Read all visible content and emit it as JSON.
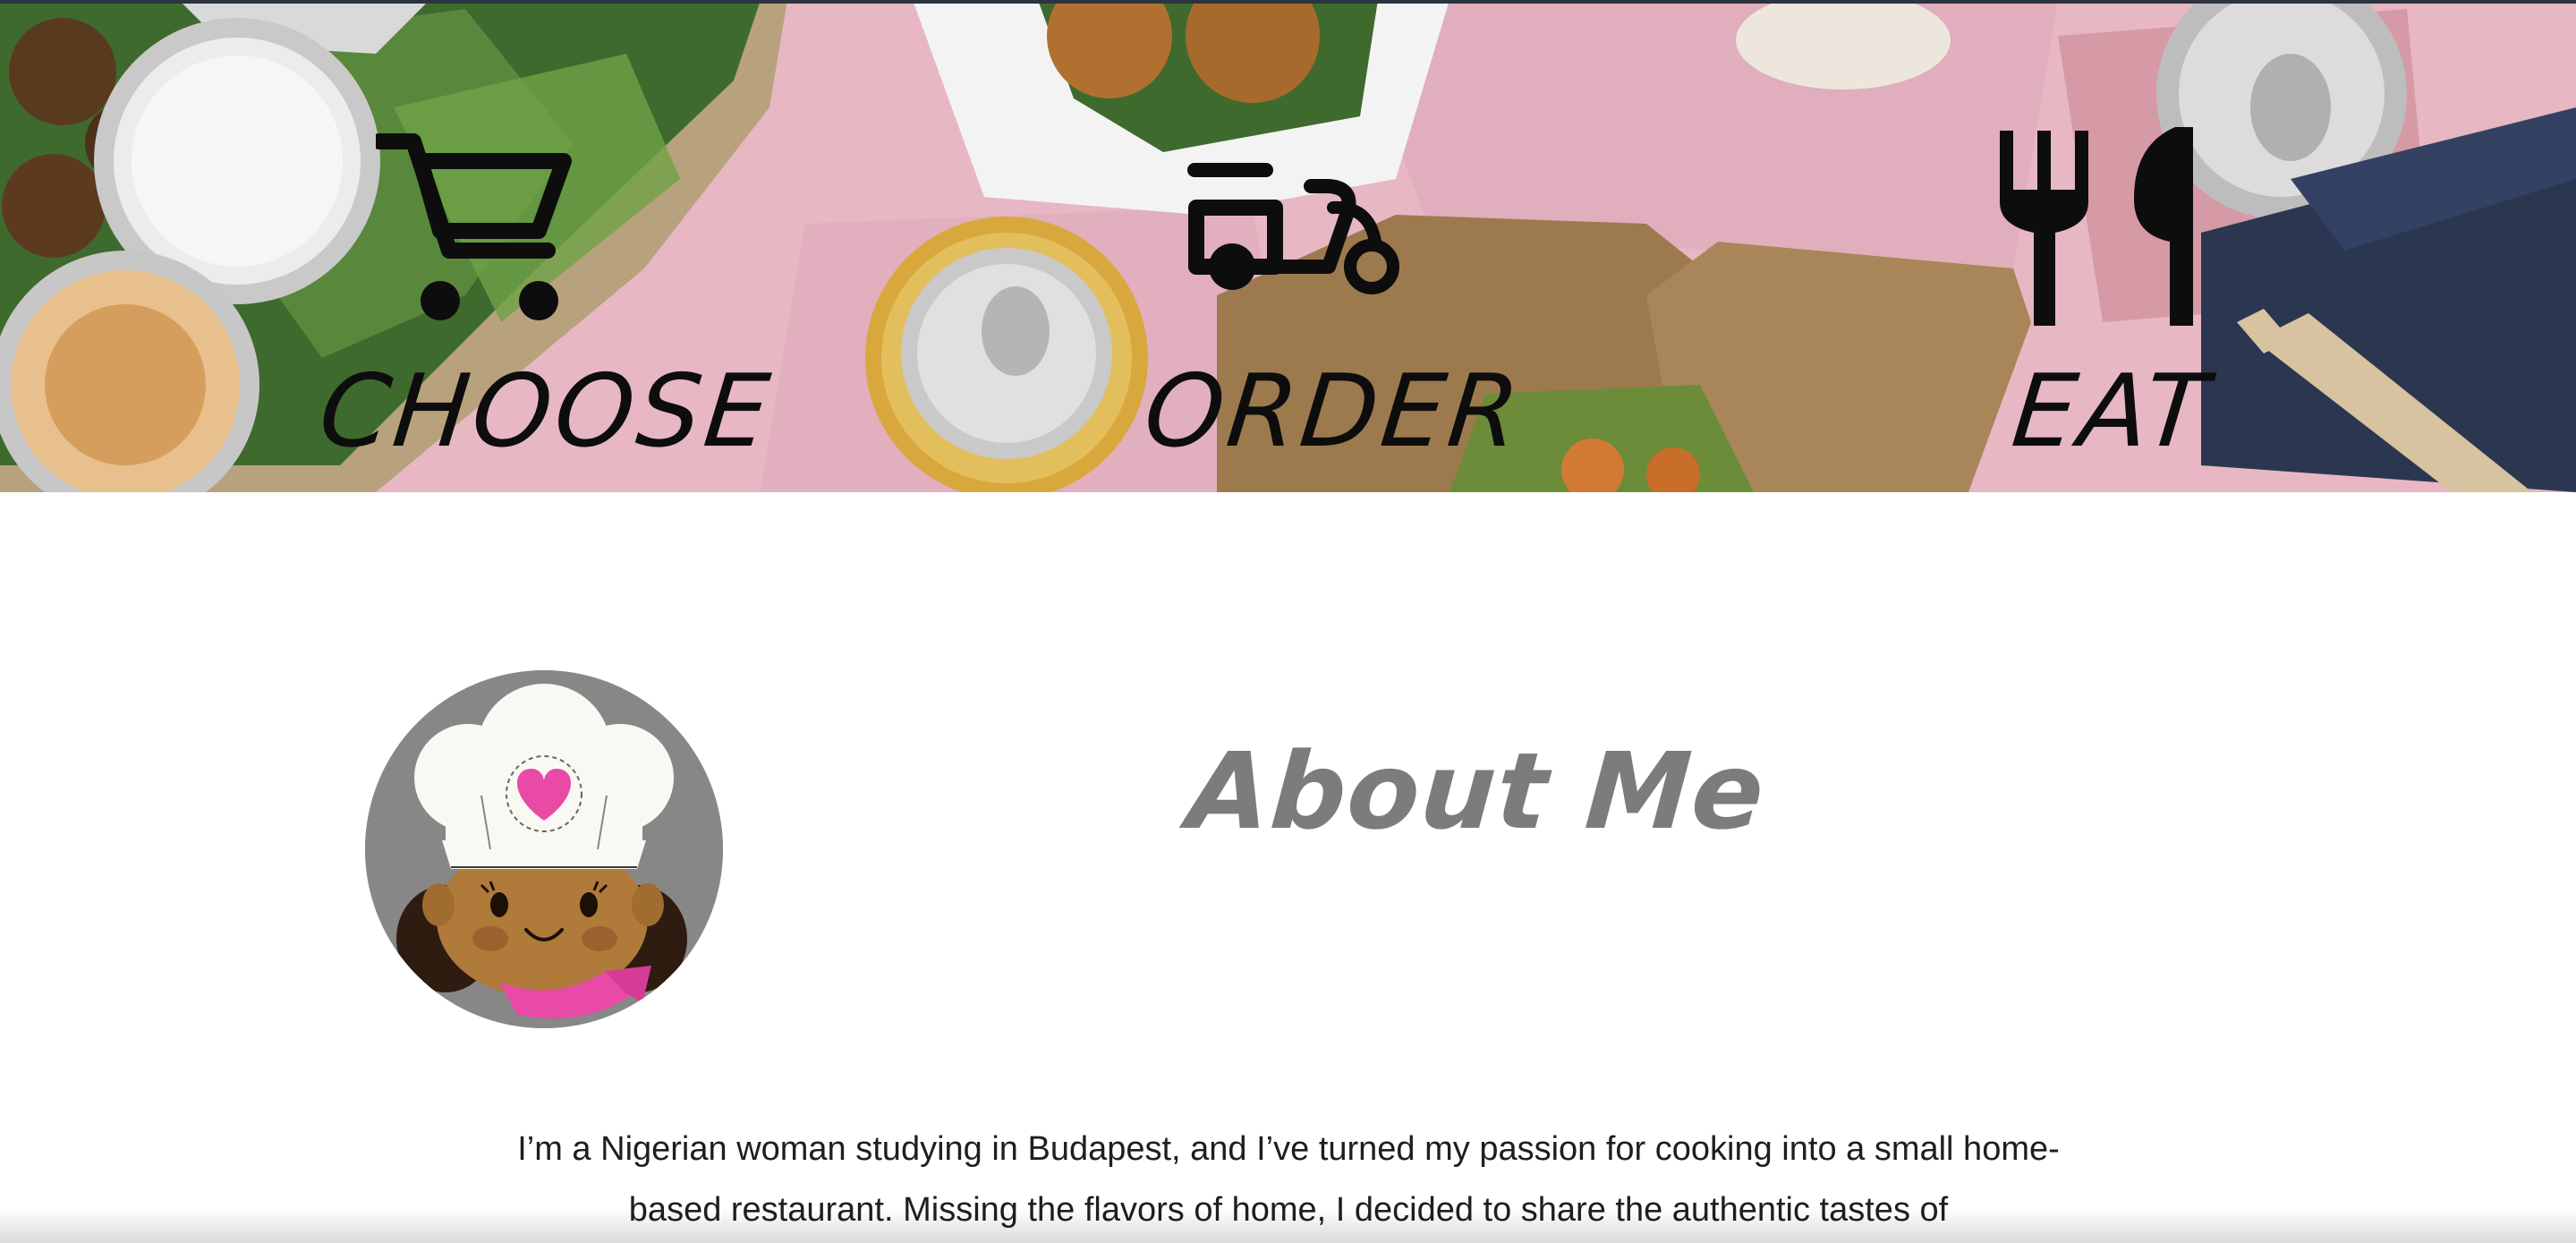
{
  "hero": {
    "steps": [
      {
        "label": "CHOOSE",
        "icon": "shopping-cart-icon"
      },
      {
        "label": "ORDER",
        "icon": "delivery-scooter-icon"
      },
      {
        "label": "EAT",
        "icon": "fork-knife-icon"
      }
    ]
  },
  "about": {
    "title": "About Me",
    "avatar_icon": "chef-girl-avatar",
    "paragraph": "I’m a Nigerian woman studying in Budapest, and I’ve turned my passion for cooking into a small home-based restaurant. Missing the flavors of home, I decided to share the authentic tastes of"
  },
  "colors": {
    "banner_pink": "#e9b9c6",
    "icon_black": "#0d0d0d",
    "title_gray": "#7c7c7c",
    "avatar_bg": "#878787",
    "heart_pink": "#e84aa6"
  }
}
